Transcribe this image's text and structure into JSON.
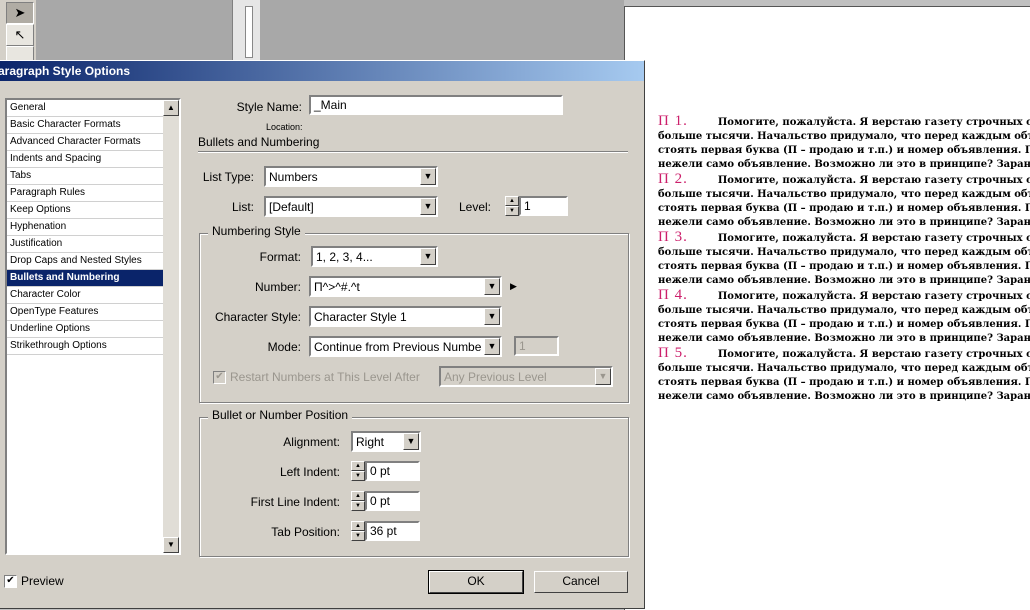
{
  "dialog": {
    "title": "aragraph Style Options",
    "style_name_label": "Style Name:",
    "style_name_value": "_Main",
    "location_label": "Location:",
    "section_title": "Bullets and Numbering",
    "list_type_label": "List Type:",
    "list_type_value": "Numbers",
    "list_label": "List:",
    "list_value": "[Default]",
    "level_label": "Level:",
    "level_value": "1",
    "numbering_style": {
      "title": "Numbering Style",
      "format_label": "Format:",
      "format_value": "1, 2, 3, 4...",
      "number_label": "Number:",
      "number_value": "П^>^#.^t",
      "char_style_label": "Character Style:",
      "char_style_value": "Character Style 1",
      "mode_label": "Mode:",
      "mode_value": "Continue from Previous Number",
      "mode_start_value": "1",
      "restart_label": "Restart Numbers at This Level After",
      "restart_value": "Any Previous Level"
    },
    "position": {
      "title": "Bullet or Number Position",
      "alignment_label": "Alignment:",
      "alignment_value": "Right",
      "left_indent_label": "Left Indent:",
      "left_indent_value": "0 pt",
      "first_line_label": "First Line Indent:",
      "first_line_value": "0 pt",
      "tab_position_label": "Tab Position:",
      "tab_position_value": "36 pt"
    },
    "preview_label": "Preview",
    "ok_label": "OK",
    "cancel_label": "Cancel",
    "categories": [
      "General",
      "Basic Character Formats",
      "Advanced Character Formats",
      "Indents and Spacing",
      "Tabs",
      "Paragraph Rules",
      "Keep Options",
      "Hyphenation",
      "Justification",
      "Drop Caps and Nested Styles",
      "Bullets and Numbering",
      "Character Color",
      "OpenType Features",
      "Underline Options",
      "Strikethrough Options"
    ],
    "selected_category_index": 10
  },
  "document": {
    "paragraphs": [
      {
        "num": "П 1.",
        "lines": [
          "Помогите, пожалуйста. Я верстаю газету строчных об",
          "больше тысячи. Начальство придумало, что перед каждым объяв",
          "стоять первая буква (П – продаю и т.п.) и номер объявления. Пр",
          "нежели само объявление. Возможно ли это в принципе? Заранее"
        ]
      },
      {
        "num": "П 2.",
        "lines": [
          "Помогите, пожалуйста. Я верстаю газету строчных об",
          "больше тысячи. Начальство придумало, что перед каждым объяв",
          "стоять первая буква (П – продаю и т.п.) и номер объявления. Пр",
          "нежели само объявление. Возможно ли это в принципе? Заранее"
        ]
      },
      {
        "num": "П 3.",
        "lines": [
          "Помогите, пожалуйста. Я верстаю газету строчных об",
          "больше тысячи. Начальство придумало, что перед каждым объяв",
          "стоять первая буква (П – продаю и т.п.) и номер объявления. Пр",
          "нежели само объявление. Возможно ли это в принципе? Заранее"
        ]
      },
      {
        "num": "П 4.",
        "lines": [
          "Помогите, пожалуйста. Я верстаю газету строчных об",
          "больше тысячи. Начальство придумало, что перед каждым объяв",
          "стоять первая буква (П – продаю и т.п.) и номер объявления. Пр",
          "нежели само объявление. Возможно ли это в принципе? Заранее"
        ]
      },
      {
        "num": "П 5.",
        "lines": [
          "Помогите, пожалуйста. Я верстаю газету строчных об",
          "больше тысячи. Начальство придумало, что перед каждым объяв",
          "стоять первая буква (П – продаю и т.п.) и номер объявления. Пр",
          "нежели само объявление. Возможно ли это в принципе? Заранее"
        ]
      }
    ]
  },
  "colors": {
    "accent": "#0a246a",
    "number_color": "#cc1f6b",
    "dialog_bg": "#d4d0c8"
  }
}
